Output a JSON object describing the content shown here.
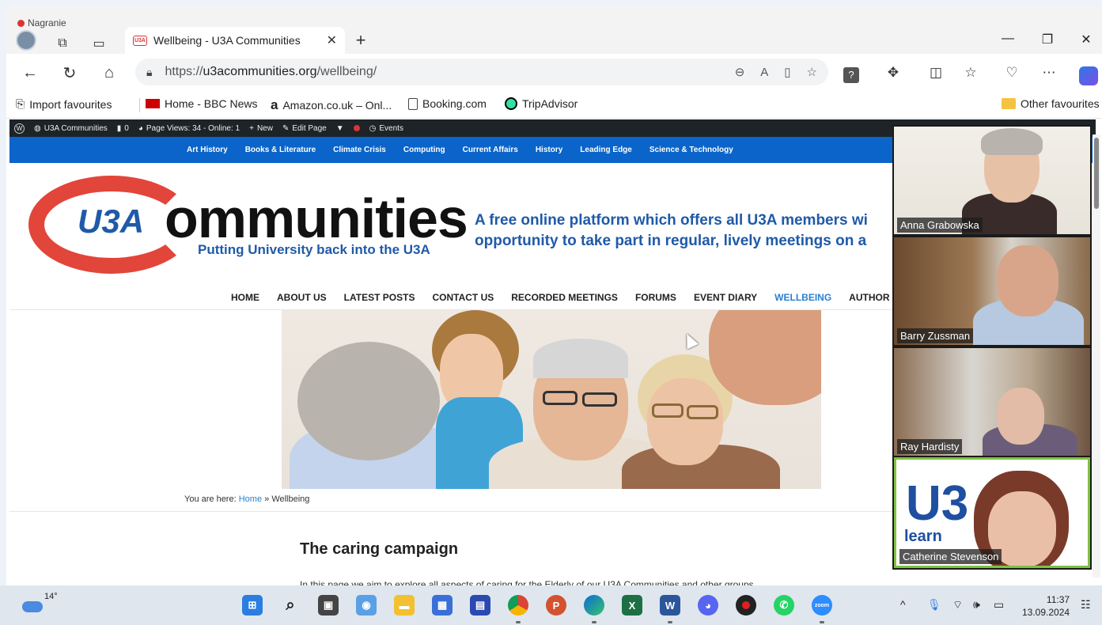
{
  "recording": {
    "label": "Nagranie"
  },
  "browser": {
    "tab_title": "Wellbeing - U3A Communities",
    "url_prefix": "https://",
    "url_domain": "u3acommunities.org",
    "url_path": "/wellbeing/",
    "favourites": [
      {
        "label": "Import favourites",
        "icon": "import-icon"
      },
      {
        "label": "Home - BBC News",
        "icon": "bbc-icon"
      },
      {
        "label": "Amazon.co.uk – Onl...",
        "icon": "amazon-icon"
      },
      {
        "label": "Booking.com",
        "icon": "page-icon"
      },
      {
        "label": "TripAdvisor",
        "icon": "tripadvisor-icon"
      }
    ],
    "other_favourites": "Other favourites"
  },
  "wp_admin": {
    "site": "U3A Communities",
    "comments": "0",
    "page_views": "Page Views: 34 - Online: 1",
    "new_label": "New",
    "edit_label": "Edit Page",
    "events_label": "Events"
  },
  "categories": [
    "Art History",
    "Books & Literature",
    "Climate Crisis",
    "Computing",
    "Current Affairs",
    "History",
    "Leading Edge",
    "Science & Technology"
  ],
  "logo": {
    "u3a": "U3A",
    "ommunities": "ommunities",
    "subtitle": "Putting University back into the U3A"
  },
  "tagline": {
    "line1": "A free online platform which offers all U3A members wi",
    "line2": "opportunity to take part in regular, lively meetings on a"
  },
  "main_nav": [
    "HOME",
    "ABOUT US",
    "LATEST POSTS",
    "CONTACT US",
    "RECORDED MEETINGS",
    "FORUMS",
    "EVENT DIARY",
    "WELLBEING",
    "AUTHOR PAGES"
  ],
  "main_nav_active": "WELLBEING",
  "breadcrumb": {
    "prefix": "You are here:",
    "home": "Home",
    "separator": "»",
    "current": "Wellbeing"
  },
  "page": {
    "heading": "The caring campaign",
    "intro": "In this page we aim to explore all aspects of caring for the Elderly of our U3A Communities and other groups"
  },
  "participants": [
    "Anna Grabowska",
    "Barry Zussman",
    "Ray Hardisty",
    "Catherine Stevenson"
  ],
  "participant_logo": {
    "letters": "U3",
    "word": "learn"
  },
  "taskbar": {
    "temperature": "14°",
    "time": "11:37",
    "date": "13.09.2024"
  },
  "colors": {
    "accent": "#0a64c9",
    "brand_red": "#e2453a",
    "brand_blue": "#1f5aa8",
    "active_speaker": "#7fc241"
  }
}
